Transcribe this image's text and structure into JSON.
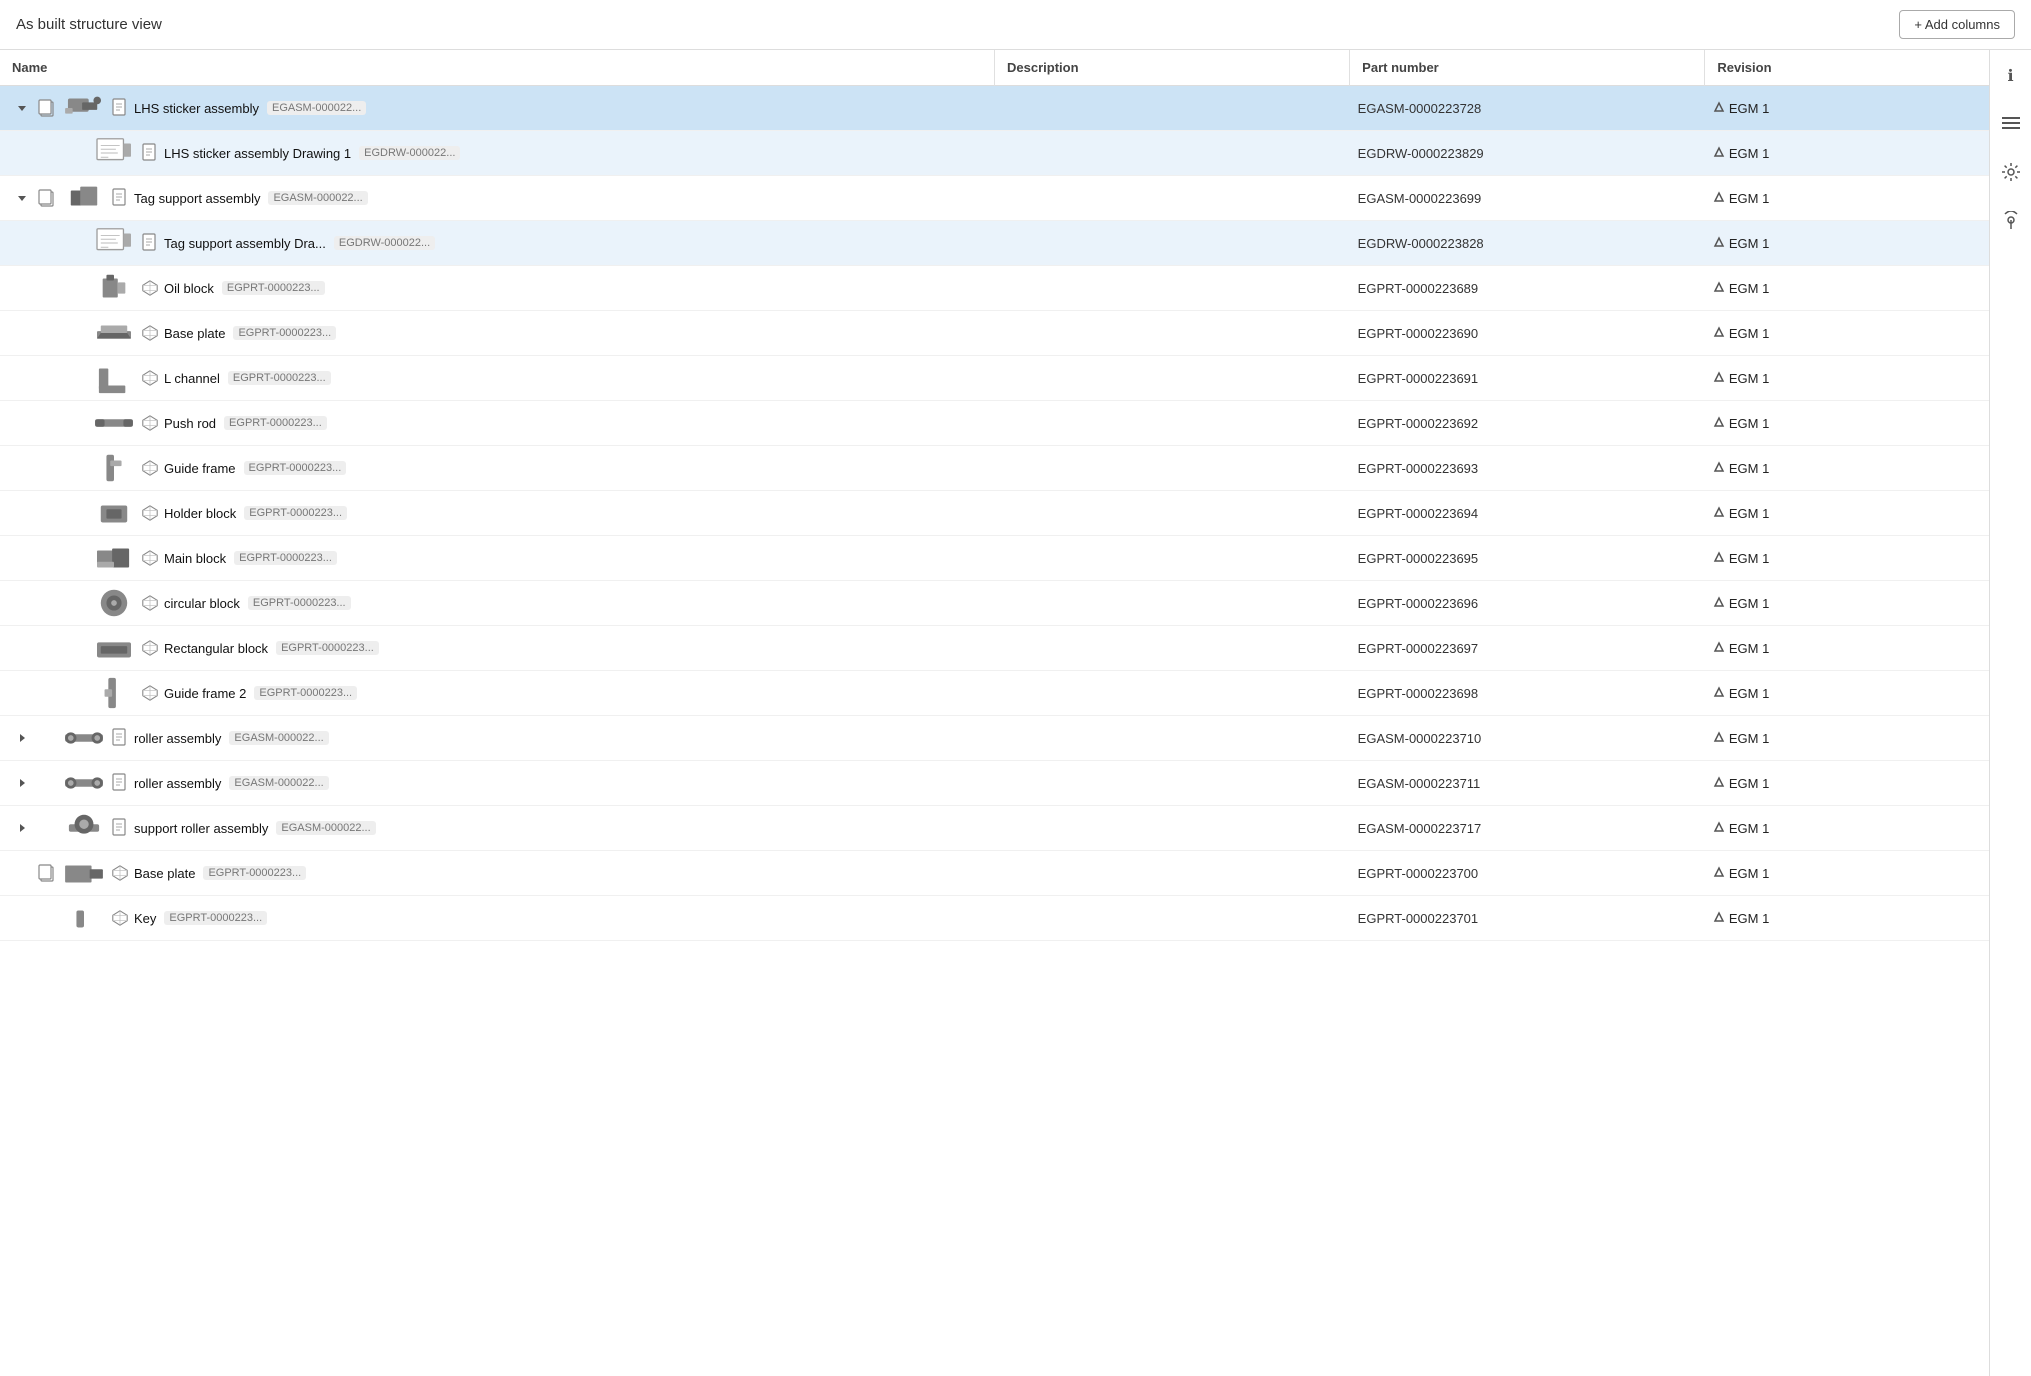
{
  "header": {
    "title": "As built structure view",
    "add_columns_label": "+ Add columns"
  },
  "columns": [
    {
      "key": "name",
      "label": "Name"
    },
    {
      "key": "description",
      "label": "Description"
    },
    {
      "key": "part_number",
      "label": "Part number"
    },
    {
      "key": "revision",
      "label": "Revision"
    }
  ],
  "rows": [
    {
      "id": "r1",
      "indent": 0,
      "expandable": true,
      "expanded": true,
      "has_copy": true,
      "has_thumb": true,
      "thumb_type": "assembly_main",
      "icon_type": "doc",
      "name": "LHS sticker assembly",
      "tag": "EGASM-000022...",
      "part_number": "EGASM-0000223728",
      "revision": "EGM 1",
      "selected": true
    },
    {
      "id": "r2",
      "indent": 1,
      "expandable": false,
      "has_copy": false,
      "has_thumb": true,
      "thumb_type": "drawing",
      "icon_type": "doc",
      "name": "LHS sticker assembly Drawing 1",
      "tag": "EGDRW-000022...",
      "part_number": "EGDRW-0000223829",
      "revision": "EGM 1",
      "highlighted": true
    },
    {
      "id": "r3",
      "indent": 0,
      "expandable": true,
      "expanded": true,
      "has_copy": true,
      "has_thumb": true,
      "thumb_type": "tag_support",
      "icon_type": "doc",
      "name": "Tag support assembly",
      "tag": "EGASM-000022...",
      "part_number": "EGASM-0000223699",
      "revision": "EGM 1"
    },
    {
      "id": "r4",
      "indent": 1,
      "expandable": false,
      "has_copy": false,
      "has_thumb": true,
      "thumb_type": "drawing",
      "icon_type": "doc",
      "name": "Tag support assembly Dra...",
      "tag": "EGDRW-000022...",
      "part_number": "EGDRW-0000223828",
      "revision": "EGM 1",
      "highlighted": true
    },
    {
      "id": "r5",
      "indent": 1,
      "expandable": false,
      "has_copy": false,
      "has_thumb": true,
      "thumb_type": "oil_block",
      "icon_type": "part",
      "name": "Oil block",
      "tag": "EGPRT-0000223...",
      "part_number": "EGPRT-0000223689",
      "revision": "EGM 1"
    },
    {
      "id": "r6",
      "indent": 1,
      "expandable": false,
      "has_copy": false,
      "has_thumb": true,
      "thumb_type": "base_plate",
      "icon_type": "part",
      "name": "Base plate",
      "tag": "EGPRT-0000223...",
      "part_number": "EGPRT-0000223690",
      "revision": "EGM 1"
    },
    {
      "id": "r7",
      "indent": 1,
      "expandable": false,
      "has_copy": false,
      "has_thumb": true,
      "thumb_type": "l_channel",
      "icon_type": "part",
      "name": "L channel",
      "tag": "EGPRT-0000223...",
      "part_number": "EGPRT-0000223691",
      "revision": "EGM 1"
    },
    {
      "id": "r8",
      "indent": 1,
      "expandable": false,
      "has_copy": false,
      "has_thumb": true,
      "thumb_type": "push_rod",
      "icon_type": "part",
      "name": "Push rod",
      "tag": "EGPRT-0000223...",
      "part_number": "EGPRT-0000223692",
      "revision": "EGM 1"
    },
    {
      "id": "r9",
      "indent": 1,
      "expandable": false,
      "has_copy": false,
      "has_thumb": true,
      "thumb_type": "guide_frame",
      "icon_type": "part",
      "name": "Guide frame",
      "tag": "EGPRT-0000223...",
      "part_number": "EGPRT-0000223693",
      "revision": "EGM 1"
    },
    {
      "id": "r10",
      "indent": 1,
      "expandable": false,
      "has_copy": false,
      "has_thumb": true,
      "thumb_type": "holder_block",
      "icon_type": "part",
      "name": "Holder block",
      "tag": "EGPRT-0000223...",
      "part_number": "EGPRT-0000223694",
      "revision": "EGM 1"
    },
    {
      "id": "r11",
      "indent": 1,
      "expandable": false,
      "has_copy": false,
      "has_thumb": true,
      "thumb_type": "main_block",
      "icon_type": "part",
      "name": "Main block",
      "tag": "EGPRT-0000223...",
      "part_number": "EGPRT-0000223695",
      "revision": "EGM 1"
    },
    {
      "id": "r12",
      "indent": 1,
      "expandable": false,
      "has_copy": false,
      "has_thumb": true,
      "thumb_type": "circular_block",
      "icon_type": "part",
      "name": "circular block",
      "tag": "EGPRT-0000223...",
      "part_number": "EGPRT-0000223696",
      "revision": "EGM 1"
    },
    {
      "id": "r13",
      "indent": 1,
      "expandable": false,
      "has_copy": false,
      "has_thumb": true,
      "thumb_type": "rectangular_block",
      "icon_type": "part",
      "name": "Rectangular block",
      "tag": "EGPRT-0000223...",
      "part_number": "EGPRT-0000223697",
      "revision": "EGM 1"
    },
    {
      "id": "r14",
      "indent": 1,
      "expandable": false,
      "has_copy": false,
      "has_thumb": true,
      "thumb_type": "guide_frame2",
      "icon_type": "part",
      "name": "Guide frame 2",
      "tag": "EGPRT-0000223...",
      "part_number": "EGPRT-0000223698",
      "revision": "EGM 1"
    },
    {
      "id": "r15",
      "indent": 0,
      "expandable": true,
      "expanded": false,
      "has_copy": false,
      "has_thumb": true,
      "thumb_type": "roller",
      "icon_type": "doc",
      "name": "roller assembly",
      "tag": "EGASM-000022...",
      "part_number": "EGASM-0000223710",
      "revision": "EGM 1"
    },
    {
      "id": "r16",
      "indent": 0,
      "expandable": true,
      "expanded": false,
      "has_copy": false,
      "has_thumb": true,
      "thumb_type": "roller",
      "icon_type": "doc",
      "name": "roller assembly",
      "tag": "EGASM-000022...",
      "part_number": "EGASM-0000223711",
      "revision": "EGM 1"
    },
    {
      "id": "r17",
      "indent": 0,
      "expandable": true,
      "expanded": false,
      "has_copy": false,
      "has_thumb": true,
      "thumb_type": "support_roller",
      "icon_type": "doc",
      "name": "support roller assembly",
      "tag": "EGASM-000022...",
      "part_number": "EGASM-0000223717",
      "revision": "EGM 1"
    },
    {
      "id": "r18",
      "indent": 0,
      "expandable": false,
      "has_copy": true,
      "has_thumb": true,
      "thumb_type": "base_plate2",
      "icon_type": "part",
      "name": "Base plate",
      "tag": "EGPRT-0000223...",
      "part_number": "EGPRT-0000223700",
      "revision": "EGM 1"
    },
    {
      "id": "r19",
      "indent": 0,
      "expandable": false,
      "has_copy": false,
      "has_thumb": true,
      "thumb_type": "key",
      "icon_type": "part",
      "name": "Key",
      "tag": "EGPRT-0000223...",
      "part_number": "EGPRT-0000223701",
      "revision": "EGM 1"
    }
  ],
  "sidebar_icons": [
    {
      "name": "info-icon",
      "glyph": "ℹ"
    },
    {
      "name": "list-icon",
      "glyph": "☰"
    },
    {
      "name": "settings-icon",
      "glyph": "⚙"
    },
    {
      "name": "bell-icon",
      "glyph": "◎"
    }
  ]
}
